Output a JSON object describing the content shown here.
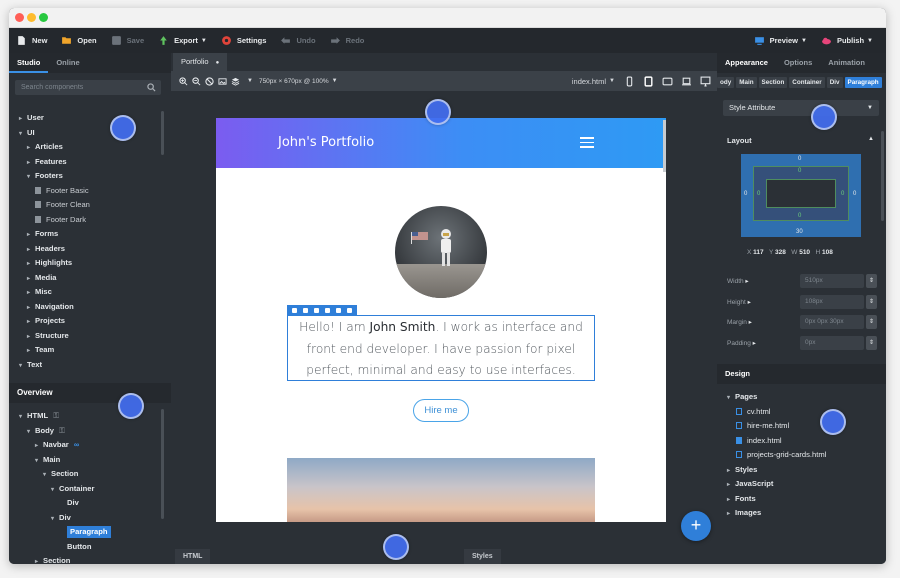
{
  "toolbar": {
    "new": "New",
    "open": "Open",
    "save": "Save",
    "export": "Export",
    "settings": "Settings",
    "undo": "Undo",
    "redo": "Redo",
    "preview": "Preview",
    "publish": "Publish"
  },
  "left_panel": {
    "tabs": [
      "Studio",
      "Online"
    ],
    "search_placeholder": "Search components",
    "components": [
      {
        "label": "User",
        "level": 0,
        "arrow": "▸",
        "type": "folder"
      },
      {
        "label": "UI",
        "level": 0,
        "arrow": "▾",
        "type": "folder"
      },
      {
        "label": "Articles",
        "level": 1,
        "arrow": "▸",
        "type": "folder"
      },
      {
        "label": "Features",
        "level": 1,
        "arrow": "▸",
        "type": "folder"
      },
      {
        "label": "Footers",
        "level": 1,
        "arrow": "▾",
        "type": "folder"
      },
      {
        "label": "Footer Basic",
        "level": 2,
        "arrow": "",
        "type": "file"
      },
      {
        "label": "Footer Clean",
        "level": 2,
        "arrow": "",
        "type": "file"
      },
      {
        "label": "Footer Dark",
        "level": 2,
        "arrow": "",
        "type": "file"
      },
      {
        "label": "Forms",
        "level": 1,
        "arrow": "▸",
        "type": "folder"
      },
      {
        "label": "Headers",
        "level": 1,
        "arrow": "▸",
        "type": "folder"
      },
      {
        "label": "Highlights",
        "level": 1,
        "arrow": "▸",
        "type": "folder"
      },
      {
        "label": "Media",
        "level": 1,
        "arrow": "▸",
        "type": "folder"
      },
      {
        "label": "Misc",
        "level": 1,
        "arrow": "▸",
        "type": "folder"
      },
      {
        "label": "Navigation",
        "level": 1,
        "arrow": "▸",
        "type": "folder"
      },
      {
        "label": "Projects",
        "level": 1,
        "arrow": "▸",
        "type": "folder"
      },
      {
        "label": "Structure",
        "level": 1,
        "arrow": "▸",
        "type": "folder"
      },
      {
        "label": "Team",
        "level": 1,
        "arrow": "▸",
        "type": "folder"
      },
      {
        "label": "Text",
        "level": 0,
        "arrow": "▾",
        "type": "folder"
      }
    ],
    "overview_tab": "Overview",
    "overview": [
      {
        "label": "HTML",
        "level": 0,
        "arrow": "▾",
        "badge": "lock"
      },
      {
        "label": "Body",
        "level": 1,
        "arrow": "▾",
        "badge": "lock"
      },
      {
        "label": "Navbar",
        "level": 2,
        "arrow": "▸",
        "badge": "link"
      },
      {
        "label": "Main",
        "level": 2,
        "arrow": "▾",
        "badge": ""
      },
      {
        "label": "Section",
        "level": 3,
        "arrow": "▾",
        "badge": ""
      },
      {
        "label": "Container",
        "level": 4,
        "arrow": "▾",
        "badge": ""
      },
      {
        "label": "Div",
        "level": 5,
        "arrow": "",
        "badge": ""
      },
      {
        "label": "Div",
        "level": 4,
        "arrow": "▾",
        "badge": ""
      },
      {
        "label": "Paragraph",
        "level": 5,
        "arrow": "",
        "badge": "",
        "selected": true
      },
      {
        "label": "Button",
        "level": 5,
        "arrow": "",
        "badge": ""
      },
      {
        "label": "Section",
        "level": 2,
        "arrow": "▸",
        "badge": ""
      }
    ]
  },
  "center": {
    "doc_tab": "Portfolio",
    "viewport_info": "750px × 670px @ 100%",
    "file_select": "index.html",
    "page": {
      "brand": "John's Portfolio",
      "para_pre": "Hello! I am ",
      "para_name": "John Smith",
      "para_post": ". I work as interface and front end developer. I have passion for pixel perfect, minimal and easy to use interfaces.",
      "hire_button": "Hire me"
    },
    "bottom_tabs": [
      "HTML",
      "Styles"
    ],
    "fab_label": "+"
  },
  "right_panel": {
    "tabs": [
      "Appearance",
      "Options",
      "Animation"
    ],
    "breadcrumbs": [
      "ody",
      "Main",
      "Section",
      "Container",
      "Div",
      "Paragraph"
    ],
    "style_select": "Style Attribute",
    "layout_title": "Layout",
    "box": {
      "margin_top": "0",
      "padding_top": "0",
      "margin_left": "0",
      "padding_left": "0",
      "padding_right": "0",
      "margin_right": "0",
      "padding_bottom": "0",
      "margin_bottom": "30"
    },
    "dims": {
      "x": "117",
      "y": "328",
      "w": "510",
      "h": "108"
    },
    "props": [
      {
        "label": "Width",
        "value": "510px"
      },
      {
        "label": "Height",
        "value": "108px"
      },
      {
        "label": "Margin",
        "value": "0px 0px 30px"
      },
      {
        "label": "Padding",
        "value": "0px"
      }
    ],
    "design_tab": "Design",
    "pages_title": "Pages",
    "pages": [
      "cv.html",
      "hire-me.html",
      "index.html",
      "projects-grid-cards.html"
    ],
    "active_page": "index.html",
    "sections": [
      "Styles",
      "JavaScript",
      "Fonts",
      "Images"
    ]
  }
}
